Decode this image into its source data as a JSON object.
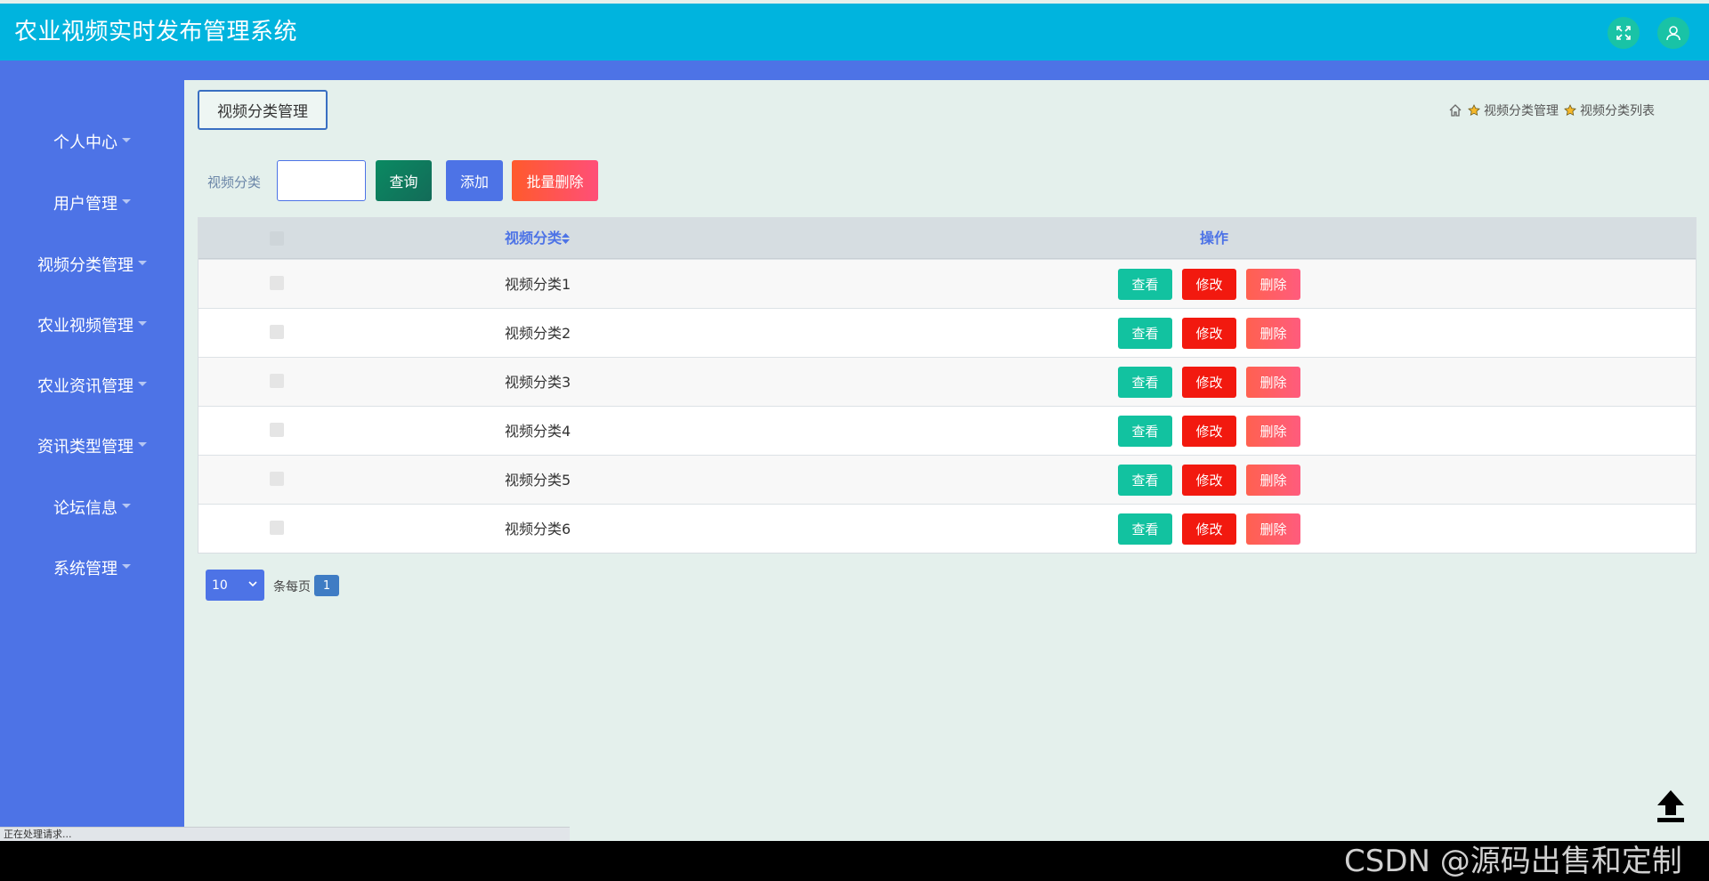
{
  "header": {
    "title": "农业视频实时发布管理系统",
    "icons": [
      "fullscreen-icon",
      "user-icon"
    ]
  },
  "sidebar": {
    "items": [
      {
        "label": "个人中心"
      },
      {
        "label": "用户管理"
      },
      {
        "label": "视频分类管理"
      },
      {
        "label": "农业视频管理"
      },
      {
        "label": "农业资讯管理"
      },
      {
        "label": "资讯类型管理"
      },
      {
        "label": "论坛信息"
      },
      {
        "label": "系统管理"
      }
    ]
  },
  "main": {
    "page_tab": "视频分类管理",
    "breadcrumb": [
      "视频分类管理",
      "视频分类列表"
    ],
    "search": {
      "label": "视频分类",
      "value": ""
    },
    "buttons": {
      "query": "查询",
      "add": "添加",
      "batch_delete": "批量删除"
    },
    "table": {
      "columns": {
        "category": "视频分类",
        "operations": "操作"
      },
      "rows": [
        {
          "category": "视频分类1"
        },
        {
          "category": "视频分类2"
        },
        {
          "category": "视频分类3"
        },
        {
          "category": "视频分类4"
        },
        {
          "category": "视频分类5"
        },
        {
          "category": "视频分类6"
        }
      ],
      "row_actions": {
        "view": "查看",
        "edit": "修改",
        "delete": "删除"
      }
    },
    "pagination": {
      "page_size": "10",
      "per_page_label": "条每页",
      "current_page": "1"
    }
  },
  "status_bar": {
    "text": "正在处理请求..."
  },
  "watermark": "CSDN @源码出售和定制",
  "colors": {
    "header": "#00b4de",
    "sidebar": "#4d73e6",
    "content_bg": "#e4f0ec",
    "view_button": "#12c2a0",
    "edit_button": "#f2190f",
    "delete_button": "#ff5c6a"
  }
}
